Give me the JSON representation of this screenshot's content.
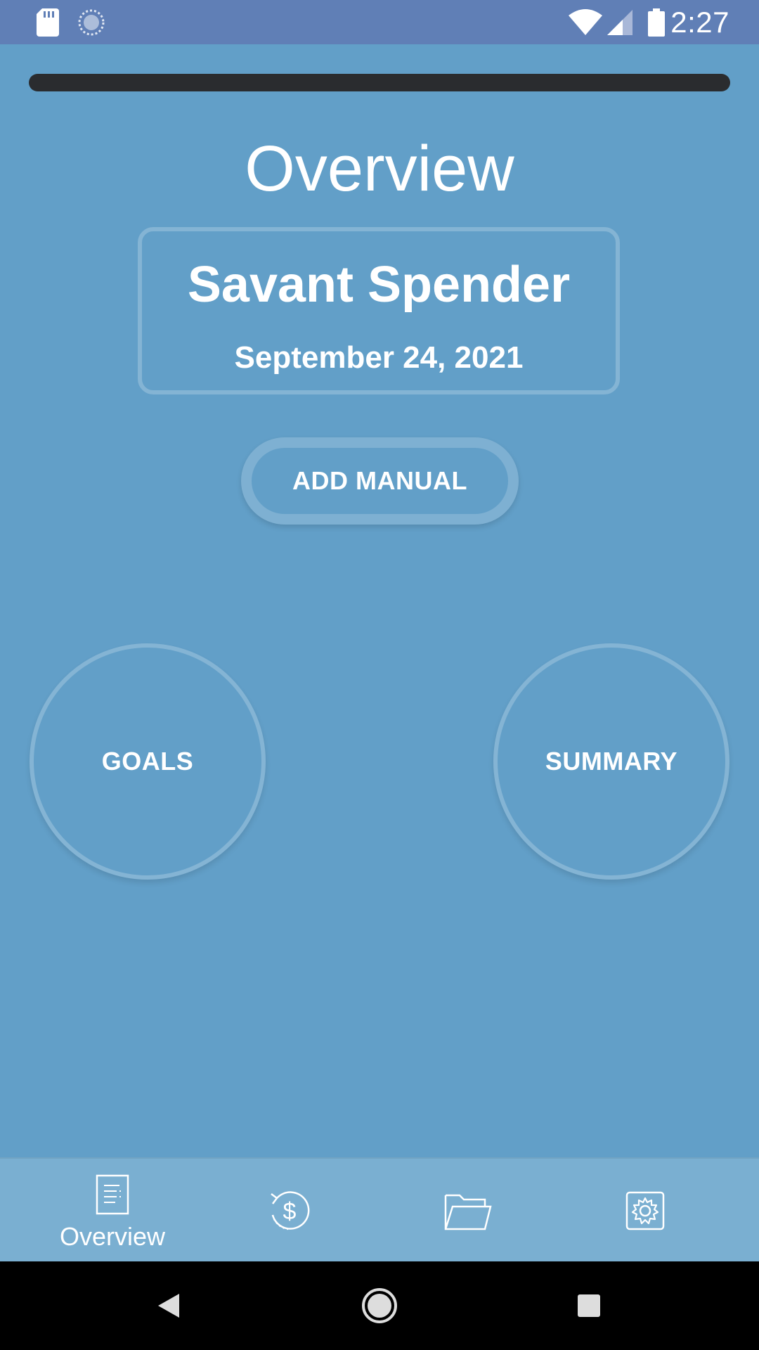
{
  "status_bar": {
    "time": "2:27",
    "icons": [
      "sd-card-icon",
      "sync-icon",
      "wifi-icon",
      "signal-icon",
      "battery-icon"
    ]
  },
  "top_bar": {
    "fill_fraction": 1.0
  },
  "page": {
    "title": "Overview"
  },
  "profile": {
    "name": "Savant Spender",
    "date": "September 24, 2021"
  },
  "actions": {
    "add_manual_label": "ADD MANUAL",
    "goals_label": "GOALS",
    "summary_label": "SUMMARY"
  },
  "bottom_nav": {
    "items": [
      {
        "label": "Overview",
        "icon": "document-icon",
        "selected": true
      },
      {
        "label": "",
        "icon": "money-history-icon",
        "selected": false
      },
      {
        "label": "",
        "icon": "folder-icon",
        "selected": false
      },
      {
        "label": "",
        "icon": "settings-gear-icon",
        "selected": false
      }
    ]
  },
  "system_nav": {
    "buttons": [
      "back-icon",
      "home-icon",
      "recents-icon"
    ]
  },
  "colors": {
    "background": "#629fc8",
    "status_bar": "#607fb6",
    "bottom_nav": "#7aafd1",
    "text": "#ffffff",
    "progress_track": "#2a2c2f"
  }
}
